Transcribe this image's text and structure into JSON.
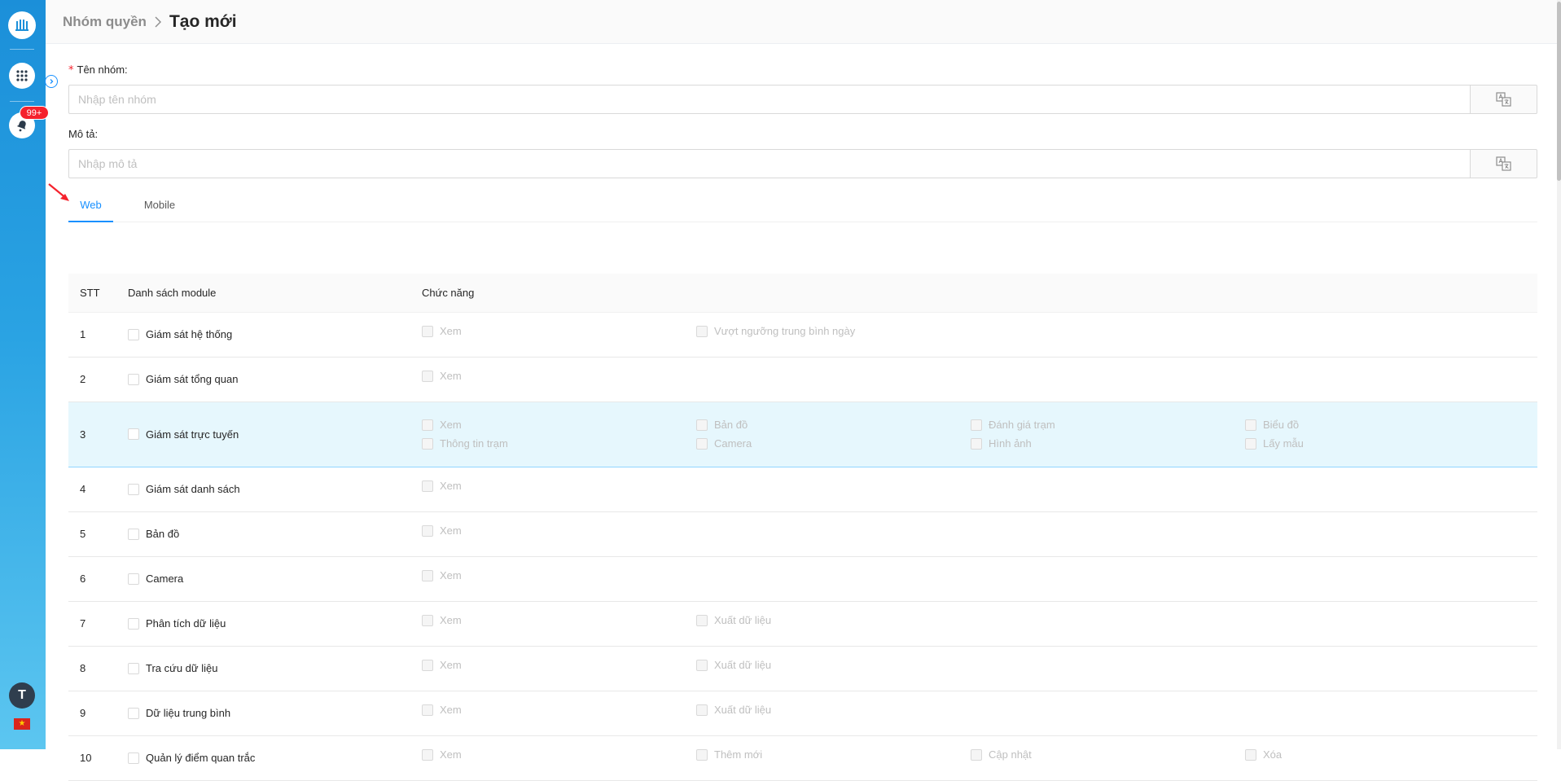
{
  "sidebar": {
    "badge": "99+",
    "user_initial": "T",
    "flag": "★"
  },
  "breadcrumb": {
    "parent": "Nhóm quyền",
    "current": "Tạo mới"
  },
  "form": {
    "name_label": "Tên nhóm",
    "name_placeholder": "Nhập tên nhóm",
    "desc_label": "Mô tả",
    "desc_placeholder": "Nhập mô tả",
    "required_mark": "*"
  },
  "tabs": {
    "web": "Web",
    "mobile": "Mobile",
    "active": "Web"
  },
  "table": {
    "headers": {
      "stt": "STT",
      "module": "Danh sách module",
      "function": "Chức năng"
    },
    "rows": [
      {
        "stt": "1",
        "module": "Giám sát hệ thống",
        "functions": [
          "Xem",
          "Vượt ngưỡng trung bình ngày"
        ]
      },
      {
        "stt": "2",
        "module": "Giám sát tổng quan",
        "functions": [
          "Xem"
        ]
      },
      {
        "stt": "3",
        "module": "Giám sát trực tuyến",
        "functions": [
          "Xem",
          "Bản đồ",
          "Đánh giá trạm",
          "Biểu đồ",
          "Thông tin trạm",
          "Camera",
          "Hình ảnh",
          "Lấy mẫu"
        ]
      },
      {
        "stt": "4",
        "module": "Giám sát danh sách",
        "functions": [
          "Xem"
        ]
      },
      {
        "stt": "5",
        "module": "Bản đồ",
        "functions": [
          "Xem"
        ]
      },
      {
        "stt": "6",
        "module": "Camera",
        "functions": [
          "Xem"
        ]
      },
      {
        "stt": "7",
        "module": "Phân tích dữ liệu",
        "functions": [
          "Xem",
          "Xuất dữ liệu"
        ]
      },
      {
        "stt": "8",
        "module": "Tra cứu dữ liệu",
        "functions": [
          "Xem",
          "Xuất dữ liệu"
        ]
      },
      {
        "stt": "9",
        "module": "Dữ liệu trung bình",
        "functions": [
          "Xem",
          "Xuất dữ liệu"
        ]
      },
      {
        "stt": "10",
        "module": "Quản lý điểm quan trắc",
        "functions": [
          "Xem",
          "Thêm mới",
          "Cập nhật",
          "Xóa"
        ]
      }
    ]
  },
  "colors": {
    "primary": "#1890ff",
    "highlight_row": "#e6f7fd",
    "required": "#f5222d",
    "badge": "#f5222d"
  }
}
